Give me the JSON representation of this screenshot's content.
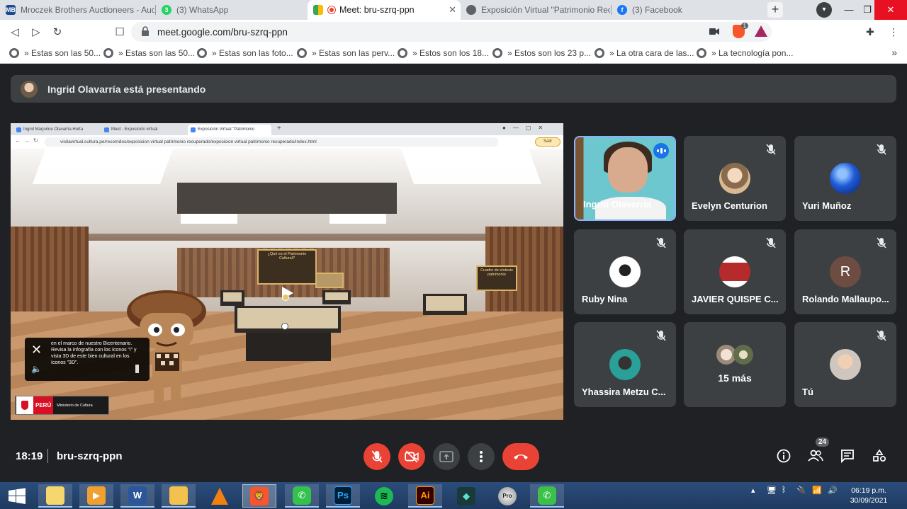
{
  "browser": {
    "tabs": [
      {
        "title": "Mroczek Brothers Auctioneers - Auc",
        "favicon": "auction-favicon",
        "color": "#1a4c8b",
        "favtext": "MB"
      },
      {
        "title": "(3) WhatsApp",
        "favicon": "whatsapp-favicon",
        "color": "#25d366",
        "favtext": "3"
      },
      {
        "title": "Meet: bru-szrq-ppn",
        "favicon": "meet-favicon",
        "color": "#00897b",
        "favtext": ""
      },
      {
        "title": "Exposición Virtual \"Patrimonio Recu",
        "favicon": "globe-favicon",
        "color": "#5f6368",
        "favtext": ""
      },
      {
        "title": "(3) Facebook",
        "favicon": "facebook-favicon",
        "color": "#1877f2",
        "favtext": "f"
      }
    ],
    "url": "meet.google.com/bru-szrq-ppn",
    "brave_badge": "1",
    "bookmarks": [
      "» Estas son las 50...",
      "» Estas son las 50...",
      "» Estas son las foto...",
      "» Estas son las perv...",
      "» Estos son los 18...",
      "» Estos son los 23 p...",
      "» La otra cara de las...",
      "» La tecnología pon..."
    ]
  },
  "meet": {
    "presenting_text": "Ingrid Olavarría está presentando",
    "shared_screen": {
      "inner_tabs": [
        "Ingrid Marjorine Olavarria Hurta",
        "Meet - Exposición virtual",
        "Exposición Virtual \"Patrimonio"
      ],
      "inner_url": "visitavirtual.cultura.pe/recorridos/exposicion virtual patrimonio recuperado/exposicion virtual patrimonio recuperado/index.html",
      "exit_label": "Salir",
      "sign_main": "¿Qué es el Patrimonio Cultural?",
      "sign_right": "Cuadro de síntesis patrimonio",
      "caption_text": "en el marco de nuestro Bicentenario. Revisa la infografía con los íconos \"i\" y vista 3D de este bien cultural en los íconos \"3D\".",
      "logo_country": "PERÚ",
      "logo_ministry": "Ministerio de Cultura"
    },
    "participants": [
      {
        "name": "Ingrid Olavarría",
        "type": "video",
        "speaking": true
      },
      {
        "name": "Evelyn Centurion",
        "muted": true,
        "avatar_color": "#d8b990"
      },
      {
        "name": "Yuri Muñoz",
        "muted": true,
        "avatar_color": "#1e5bd8"
      },
      {
        "name": "Ruby Nina",
        "muted": true,
        "avatar_color": "#ffffff"
      },
      {
        "name": "JAVIER QUISPE C...",
        "muted": true,
        "avatar_color": "#b52a2a"
      },
      {
        "name": "Rolando Mallaupo...",
        "muted": true,
        "initial": "R",
        "avatar_color": "#6d4c41"
      },
      {
        "name": "Yhassira Metzu C...",
        "muted": true,
        "avatar_color": "#2aa198"
      },
      {
        "more_label": "15 más"
      },
      {
        "name": "Tú",
        "muted": true,
        "avatar_color": "#cfc7bd"
      }
    ],
    "time": "18:19",
    "meeting_code": "bru-szrq-ppn",
    "people_count": "24"
  },
  "taskbar": {
    "apps": [
      {
        "name": "start",
        "color": "#3a78d6",
        "label": ""
      },
      {
        "name": "sticky-notes",
        "color": "#f5d76e",
        "label": ""
      },
      {
        "name": "media-player",
        "color": "#f0a030",
        "label": ""
      },
      {
        "name": "word",
        "color": "#2b579a",
        "label": "W"
      },
      {
        "name": "file-explorer",
        "color": "#f2c14e",
        "label": ""
      },
      {
        "name": "vlc",
        "color": "#f08010",
        "label": ""
      },
      {
        "name": "brave",
        "color": "#fb542b",
        "label": ""
      },
      {
        "name": "phone-green",
        "color": "#33c24d",
        "label": ""
      },
      {
        "name": "photoshop",
        "color": "#001e36",
        "label": "Ps"
      },
      {
        "name": "spotify",
        "color": "#1db954",
        "label": ""
      },
      {
        "name": "illustrator",
        "color": "#330000",
        "label": "Ai"
      },
      {
        "name": "filmora",
        "color": "#1a3a3a",
        "label": ""
      },
      {
        "name": "pro-app",
        "color": "#cfcfcf",
        "label": ""
      },
      {
        "name": "green-app",
        "color": "#3bc04a",
        "label": ""
      }
    ],
    "time": "06:19 p.m.",
    "date": "30/09/2021"
  }
}
